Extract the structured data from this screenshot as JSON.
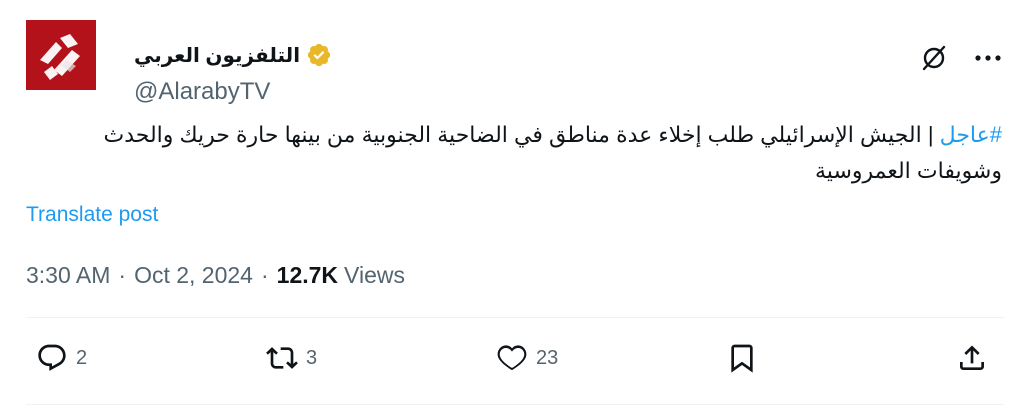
{
  "account": {
    "display_name": "التلفزيون العربي",
    "handle": "@AlarabyTV",
    "verified_icon": "verified-badge-icon",
    "verified_color": "#e8b829",
    "avatar_color": "#b3121b"
  },
  "tweet": {
    "hashtag": "#عاجل",
    "text": " | الجيش الإسرائيلي طلب إخلاء عدة مناطق في الضاحية الجنوبية من بينها حارة حريك والحدث وشويفات العمروسية",
    "translate_label": "Translate post",
    "time": "3:30 AM",
    "date": "Oct 2, 2024",
    "separator": "·",
    "views_count": "12.7K",
    "views_label": "Views"
  },
  "actions": {
    "replies": "2",
    "reposts": "3",
    "likes": "23"
  },
  "colors": {
    "accent": "#1d9bf0",
    "text": "#0f1419",
    "muted": "#536471"
  }
}
